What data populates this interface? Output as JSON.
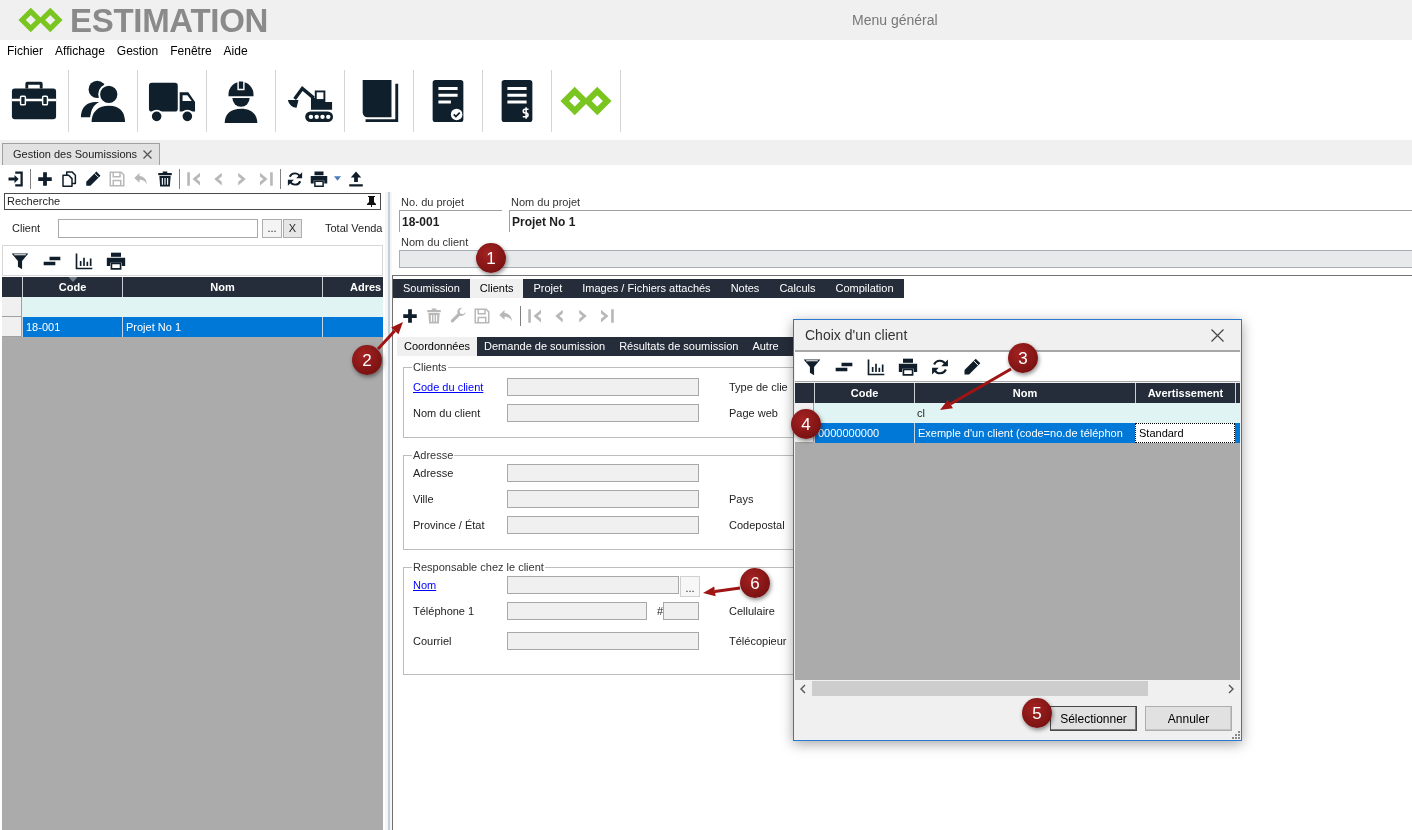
{
  "app": {
    "logo_text": "ESTIMATION",
    "title": "Menu général"
  },
  "menu": [
    "Fichier",
    "Affichage",
    "Gestion",
    "Fenêtre",
    "Aide"
  ],
  "document_tab": {
    "label": "Gestion des Soumissions"
  },
  "main_toolbar": [
    [
      {
        "kind": "exit",
        "disabled": false
      }
    ],
    [
      {
        "kind": "add",
        "disabled": false
      },
      {
        "kind": "copy",
        "disabled": false
      },
      {
        "kind": "edit",
        "disabled": false
      },
      {
        "kind": "save",
        "disabled": true
      },
      {
        "kind": "undo",
        "disabled": true
      },
      {
        "kind": "delete",
        "disabled": false
      }
    ],
    [
      {
        "kind": "first",
        "disabled": true
      },
      {
        "kind": "prev",
        "disabled": true
      },
      {
        "kind": "next",
        "disabled": true
      },
      {
        "kind": "last",
        "disabled": true
      }
    ],
    [
      {
        "kind": "refresh",
        "disabled": false
      },
      {
        "kind": "print",
        "disabled": false
      },
      {
        "kind": "dropdown",
        "disabled": false
      },
      {
        "kind": "upload",
        "disabled": false
      }
    ]
  ],
  "search_panel": {
    "title": "Recherche",
    "client_label": "Client",
    "browse_button": "...",
    "clear_button": "X",
    "total_label": "Total Venda",
    "toolbar": [
      {
        "kind": "filter",
        "disabled": false
      },
      {
        "kind": "group",
        "disabled": false
      },
      {
        "kind": "chart",
        "disabled": false
      },
      {
        "kind": "print",
        "disabled": false
      }
    ],
    "grid": {
      "columns": [
        {
          "label": "Code",
          "sorted": true
        },
        {
          "label": "Nom",
          "sorted": false
        },
        {
          "label": "Adres",
          "sorted": false
        }
      ],
      "rows": [
        {
          "selected": true,
          "cells": [
            {
              "text": "18-001",
              "focused": false
            },
            {
              "text": "Projet No 1",
              "focused": false
            }
          ]
        }
      ]
    }
  },
  "project": {
    "fields": [
      {
        "label": "No. du projet",
        "value": "18-001"
      },
      {
        "label": "Nom du projet",
        "value": "Projet No 1"
      }
    ],
    "client_label": "Nom du client"
  },
  "tabs": [
    {
      "label": "Soumission",
      "selected": false
    },
    {
      "label": "Clients",
      "selected": true
    },
    {
      "label": "Projet",
      "selected": false
    },
    {
      "label": "Images / Fichiers attachés",
      "selected": false
    },
    {
      "label": "Notes",
      "selected": false
    },
    {
      "label": "Calculs",
      "selected": false
    },
    {
      "label": "Compilation",
      "selected": false
    }
  ],
  "client_toolbar": [
    [
      {
        "kind": "add",
        "disabled": false
      },
      {
        "kind": "delete",
        "disabled": true
      },
      {
        "kind": "wrench",
        "disabled": true
      },
      {
        "kind": "save",
        "disabled": true
      },
      {
        "kind": "undo",
        "disabled": true
      }
    ],
    [
      {
        "kind": "first",
        "disabled": true
      },
      {
        "kind": "prev",
        "disabled": true
      },
      {
        "kind": "next",
        "disabled": true
      },
      {
        "kind": "last",
        "disabled": true
      }
    ]
  ],
  "subtabs": [
    {
      "label": "Coordonnées",
      "selected": true
    },
    {
      "label": "Demande de soumission",
      "selected": false
    },
    {
      "label": "Résultats de soumission",
      "selected": false
    },
    {
      "label": "Autre",
      "selected": false
    }
  ],
  "groups": [
    {
      "title": "Clients",
      "rows": [
        {
          "kind": "text",
          "label": "Code du client",
          "link": true,
          "right_label": "Type de clie"
        },
        {
          "kind": "text",
          "label": "Nom du client",
          "link": false,
          "right_label": "Page web"
        }
      ]
    },
    {
      "title": "Adresse",
      "rows": [
        {
          "kind": "text",
          "label": "Adresse",
          "link": false
        },
        {
          "kind": "text",
          "label": "Ville",
          "link": false,
          "right_label": "Pays"
        },
        {
          "kind": "text",
          "label": "Province / État",
          "link": false,
          "right_label": "Codepostal"
        }
      ]
    },
    {
      "title": "Responsable chez le client",
      "rows": [
        {
          "kind": "lookup",
          "label": "Nom",
          "link": true,
          "button": "..."
        },
        {
          "kind": "phone",
          "label": "Téléphone 1",
          "link": false,
          "extension_label": "#",
          "right_label": "Cellulaire"
        },
        {
          "kind": "text",
          "label": "Courriel",
          "link": false,
          "right_label": "Télécopieur"
        }
      ]
    }
  ],
  "dialog": {
    "title": "Choix d'un client",
    "toolbar": [
      {
        "kind": "filter",
        "disabled": false
      },
      {
        "kind": "group",
        "disabled": false
      },
      {
        "kind": "chart",
        "disabled": false
      },
      {
        "kind": "print",
        "disabled": false
      },
      {
        "kind": "refresh",
        "disabled": false
      },
      {
        "kind": "edit",
        "disabled": false
      }
    ],
    "grid": {
      "columns": [
        {
          "label": "Code",
          "sorted": false
        },
        {
          "label": "Nom",
          "sorted": false,
          "filter": "cl"
        },
        {
          "label": "Avertissement",
          "sorted": false
        }
      ],
      "rows": [
        {
          "selected": true,
          "cells": [
            {
              "text": "0000000000",
              "focused": false
            },
            {
              "text": "Exemple d'un client (code=no.de téléphon",
              "focused": false
            },
            {
              "text": "Standard",
              "focused": true
            }
          ]
        }
      ]
    },
    "buttons": [
      {
        "label": "Sélectionner",
        "default": true
      },
      {
        "label": "Annuler",
        "default": false
      }
    ]
  },
  "callouts": [
    {
      "label": "1",
      "arrow": false
    },
    {
      "label": "2",
      "arrow": true
    },
    {
      "label": "3",
      "arrow": true
    },
    {
      "label": "4",
      "arrow": false
    },
    {
      "label": "5",
      "arrow": false
    },
    {
      "label": "6",
      "arrow": true
    }
  ]
}
